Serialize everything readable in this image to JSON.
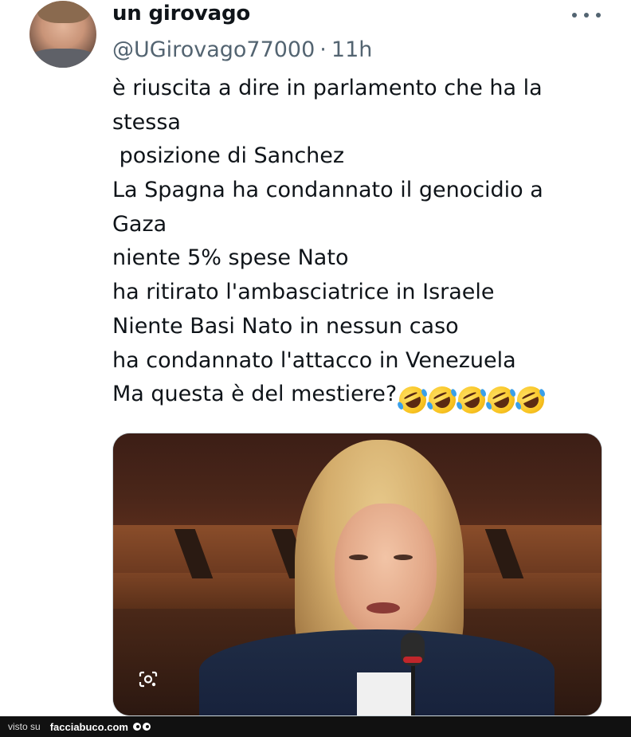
{
  "author": {
    "display_name": "un girovago",
    "handle": "@UGirovago77000",
    "separator": "·",
    "time": "11h"
  },
  "tweet": {
    "lines": [
      "è riuscita a dire in parlamento che ha la",
      "stessa",
      " posizione di Sanchez",
      "La Spagna ha condannato il genocidio a",
      "Gaza",
      "niente 5% spese Nato",
      "ha ritirato l'ambasciatrice in Israele",
      "Niente Basi Nato in nessun caso",
      "ha condannato l'attacco in Venezuela",
      "Ma questa è del mestiere?"
    ],
    "emoji": [
      "rofl-icon",
      "rofl-icon",
      "rofl-icon",
      "rofl-icon",
      "rofl-icon"
    ]
  },
  "icons": {
    "more": "more-options-icon",
    "lens": "google-lens-icon"
  },
  "footer": {
    "prefix": "visto su",
    "site": "facciabuco.com"
  },
  "colors": {
    "text": "#0f1419",
    "secondary": "#536471",
    "border": "#cfd9de",
    "footer_bg": "#111111"
  }
}
